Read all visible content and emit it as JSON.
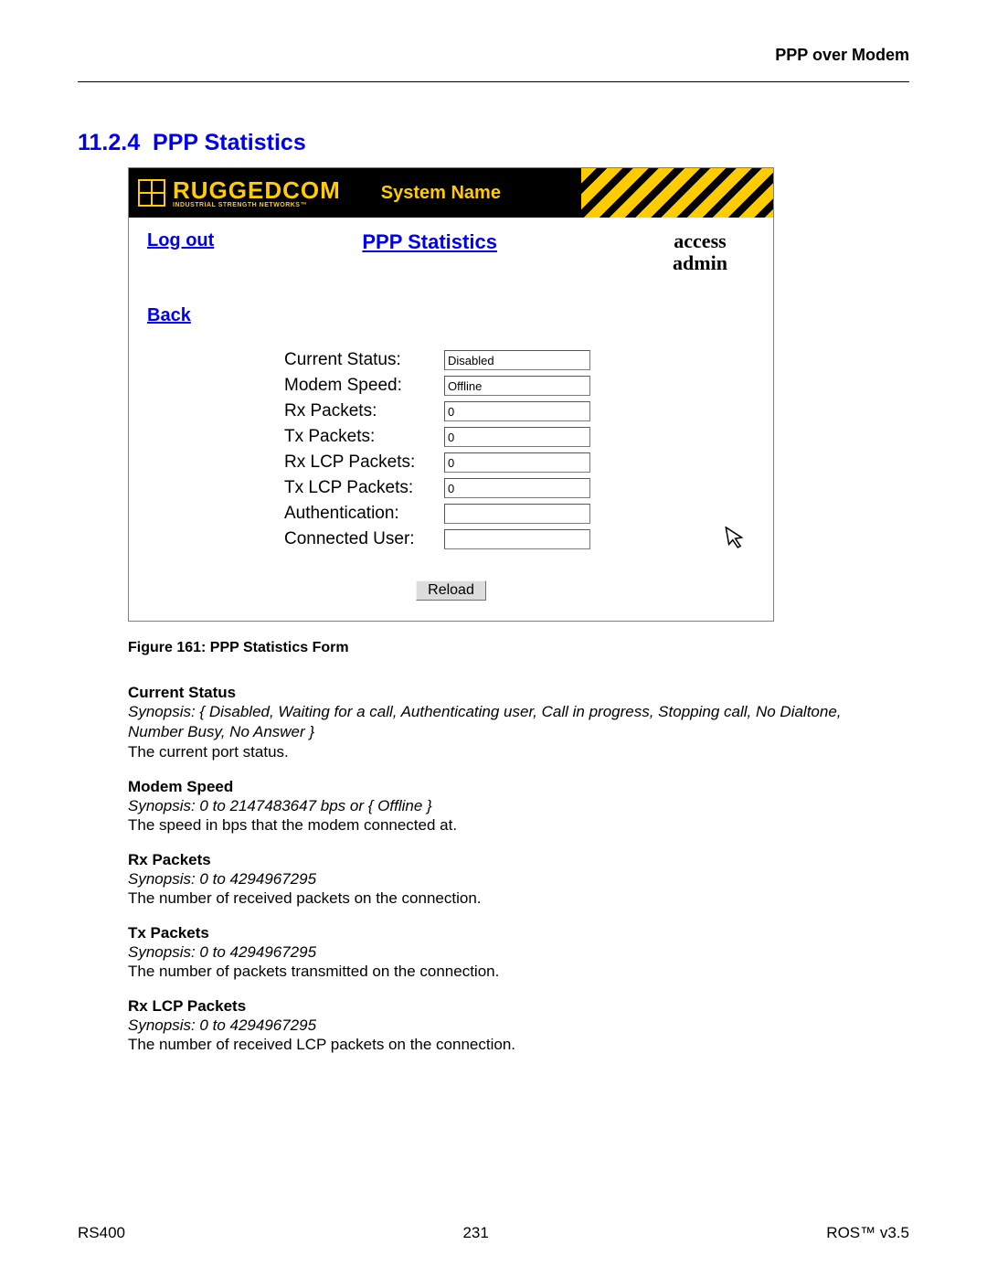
{
  "header": {
    "right": "PPP over Modem"
  },
  "section": {
    "number": "11.2.4",
    "title": "PPP Statistics"
  },
  "screenshot": {
    "brand": {
      "main": "RUGGEDCOM",
      "tag": "INDUSTRIAL STRENGTH NETWORKS™"
    },
    "system_name": "System Name",
    "links": {
      "logout": "Log out",
      "back": "Back"
    },
    "page_title": "PPP Statistics",
    "access": {
      "line1": "access",
      "line2": "admin"
    },
    "fields": [
      {
        "label": "Current Status:",
        "value": "Disabled"
      },
      {
        "label": "Modem Speed:",
        "value": "Offline"
      },
      {
        "label": "Rx Packets:",
        "value": "0"
      },
      {
        "label": "Tx Packets:",
        "value": "0"
      },
      {
        "label": "Rx LCP Packets:",
        "value": "0"
      },
      {
        "label": "Tx LCP Packets:",
        "value": "0"
      },
      {
        "label": "Authentication:",
        "value": ""
      },
      {
        "label": "Connected User:",
        "value": ""
      }
    ],
    "reload": "Reload"
  },
  "figure_caption": "Figure 161: PPP Statistics Form",
  "docs": [
    {
      "title": "Current Status",
      "synopsis": "Synopsis: { Disabled, Waiting for a call, Authenticating user, Call in progress, Stopping call, No Dialtone, Number Busy, No Answer }",
      "desc": "The current port status."
    },
    {
      "title": "Modem Speed",
      "synopsis": "Synopsis: 0 to 2147483647 bps or { Offline }",
      "desc": "The speed in bps that the modem connected at."
    },
    {
      "title": "Rx Packets",
      "synopsis": "Synopsis: 0 to 4294967295",
      "desc": "The number of received packets on the connection."
    },
    {
      "title": "Tx Packets",
      "synopsis": "Synopsis: 0 to 4294967295",
      "desc": "The number of packets transmitted on the connection."
    },
    {
      "title": "Rx LCP Packets",
      "synopsis": "Synopsis: 0 to 4294967295",
      "desc": "The number of received LCP packets on the connection."
    }
  ],
  "footer": {
    "left": "RS400",
    "center": "231",
    "right": "ROS™  v3.5"
  }
}
